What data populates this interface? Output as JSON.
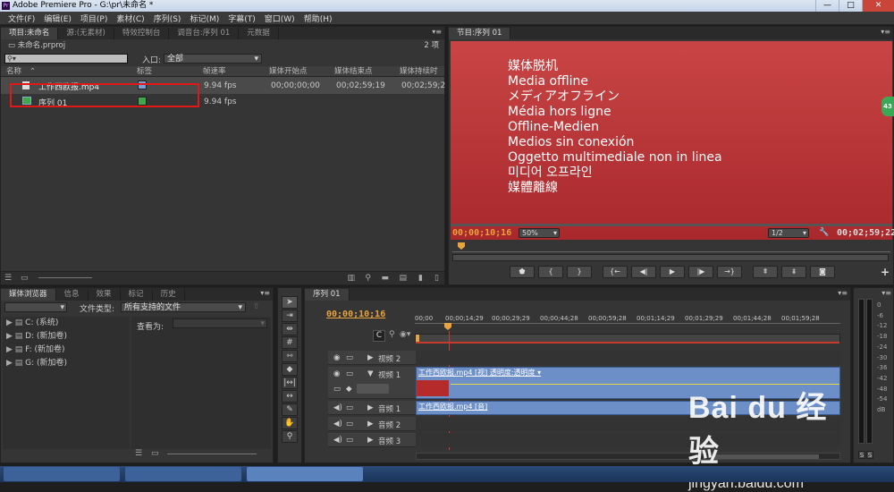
{
  "window": {
    "title": "Adobe Premiere Pro - G:\\pr\\未命名 *",
    "app_icon": "Pr",
    "min": "—",
    "max": "□",
    "close": "✕"
  },
  "menu": [
    "文件(F)",
    "编辑(E)",
    "项目(P)",
    "素材(C)",
    "序列(S)",
    "标记(M)",
    "字幕(T)",
    "窗口(W)",
    "帮助(H)"
  ],
  "project_panel": {
    "tabs": [
      "项目:未命名",
      "源:(无素材)",
      "特效控制台",
      "调音台:序列 01",
      "元数据"
    ],
    "project_file": "未命名.prproj",
    "item_count": "2 项",
    "search_placeholder": "",
    "entry_label": "入口:",
    "entry_value": "全部",
    "columns": [
      "名称",
      "标签",
      "帧速率",
      "媒体开始点",
      "媒体结束点",
      "媒体持续时"
    ],
    "rows": [
      {
        "name": "工作西欧报.mp4",
        "label_color": "#7d9bd4",
        "fps": "9.94 fps",
        "start": "00;00;00;00",
        "end": "00;02;59;19",
        "dur": "00;02;59;2"
      },
      {
        "name": "序列 01",
        "label_color": "#3fa84a",
        "fps": "9.94 fps",
        "start": "",
        "end": "",
        "dur": ""
      }
    ]
  },
  "program_monitor": {
    "tab": "节目:序列 01",
    "offline_lines": [
      "媒体脱机",
      "Media offline",
      "メディアオフライン",
      "Média hors ligne",
      "Offline-Medien",
      "Medios sin conexión",
      "Oggetto multimediale non in linea",
      "미디어 오프라인",
      "媒體離線"
    ],
    "timecode": "00;00;10;16",
    "zoom": "50%",
    "resolution": "1/2",
    "duration": "00;02;59;22",
    "badge": "43",
    "bg_color": "#c23a3a"
  },
  "media_browser": {
    "tabs": [
      "媒体浏览器",
      "信息",
      "效果",
      "标记",
      "历史"
    ],
    "file_type_label": "文件类型:",
    "file_type_value": "所有支持的文件",
    "view_as_label": "查看为:",
    "drives": [
      "C: (系统)",
      "D: (新加卷)",
      "F: (新加卷)",
      "G: (新加卷)"
    ]
  },
  "timeline": {
    "tab": "序列 01",
    "timecode": "00;00;10;16",
    "ruler": [
      "00;00",
      "00;00;14;29",
      "00;00;29;29",
      "00;00;44;28",
      "00;00;59;28",
      "00;01;14;29",
      "00;01;29;29",
      "00;01;44;28",
      "00;01;59;28"
    ],
    "tracks_video": [
      "视频 2",
      "视频 1"
    ],
    "tracks_audio": [
      "音频 1",
      "音频 2",
      "音频 3"
    ],
    "video_clip": "工作西欧报.mp4 [视] 透明度:透明度 ▾",
    "audio_clip": "工作西欧报.mp4 [音]"
  },
  "audio_meter": {
    "scale": [
      "0",
      "-6",
      "-12",
      "-18",
      "-24",
      "-30",
      "-36",
      "-42",
      "-48",
      "-54",
      "dB"
    ],
    "solo_labels": [
      "S",
      "S"
    ]
  },
  "watermark": {
    "brand": "Bai du 经验",
    "url": "jingyan.baidu.com"
  }
}
